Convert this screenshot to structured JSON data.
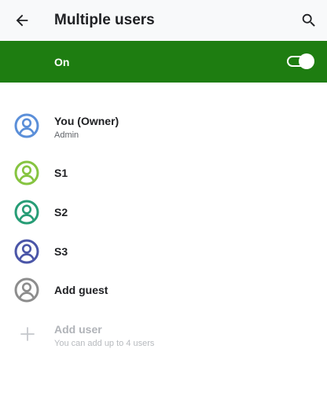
{
  "header": {
    "title": "Multiple users",
    "back_icon": "arrow-back-icon",
    "search_icon": "search-icon"
  },
  "master_switch": {
    "label": "On",
    "checked": true,
    "background": "#1e7d11"
  },
  "users": [
    {
      "name": "You (Owner)",
      "subtitle": "Admin",
      "icon": "account-circle-icon",
      "color": "#5b8fd9"
    },
    {
      "name": "S1",
      "subtitle": "",
      "icon": "account-circle-icon",
      "color": "#86c440"
    },
    {
      "name": "S2",
      "subtitle": "",
      "icon": "account-circle-icon",
      "color": "#279d76"
    },
    {
      "name": "S3",
      "subtitle": "",
      "icon": "account-circle-icon",
      "color": "#4b56a8"
    },
    {
      "name": "Add guest",
      "subtitle": "",
      "icon": "account-circle-icon",
      "color": "#8d8d8d"
    }
  ],
  "add_user": {
    "label": "Add user",
    "subtitle": "You can add up to 4 users",
    "icon": "plus-icon",
    "enabled": false
  }
}
